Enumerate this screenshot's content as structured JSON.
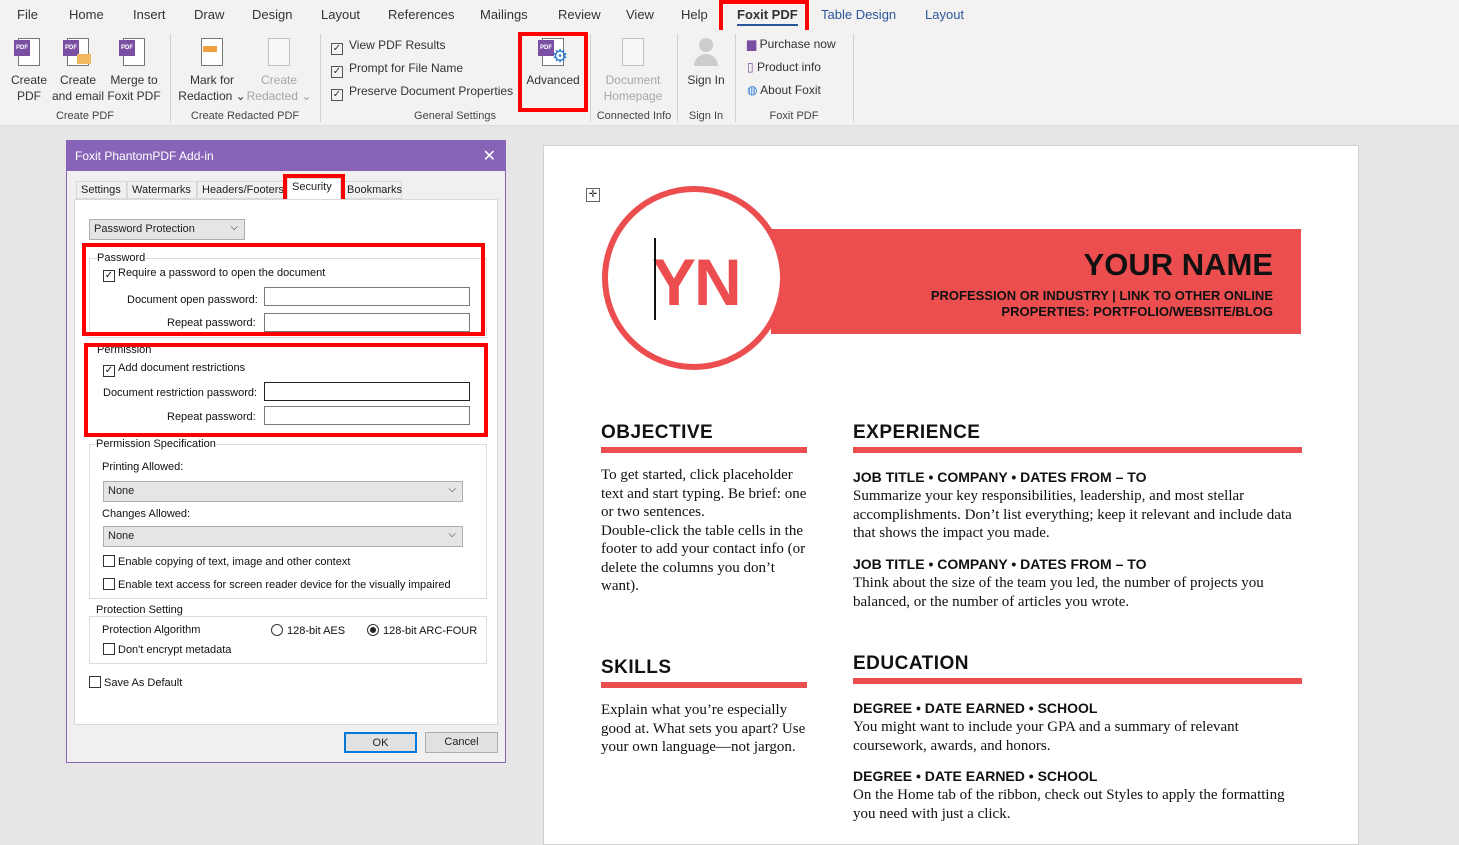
{
  "menu_tabs": [
    "File",
    "Home",
    "Insert",
    "Draw",
    "Design",
    "Layout",
    "References",
    "Mailings",
    "Review",
    "View",
    "Help",
    "Foxit PDF",
    "Table Design",
    "Layout"
  ],
  "ribbon": {
    "create_pdf": [
      "Create PDF",
      "Create and email",
      "Merge to Foxit PDF"
    ],
    "create_pdf_group": "Create PDF",
    "mark_redaction": "Mark for Redaction",
    "create_redacted": "Create Redacted",
    "redacted_group": "Create Redacted PDF",
    "checks": [
      "View PDF Results",
      "Prompt for File Name",
      "Preserve Document Properties"
    ],
    "advanced": "Advanced",
    "general_group": "General Settings",
    "doc_homepage": "Document Homepage",
    "connected_group": "Connected Info",
    "sign_in": "Sign In",
    "sign_in_group": "Sign In",
    "links": [
      "Purchase now",
      "Product info",
      "About Foxit"
    ],
    "foxit_group": "Foxit PDF"
  },
  "dialog": {
    "title": "Foxit PhantomPDF Add-in",
    "close": "✕",
    "tabs": [
      "Settings",
      "Watermarks",
      "Headers/Footers",
      "Security",
      "Bookmarks"
    ],
    "mode": "Password Protection",
    "password_legend": "Password",
    "require_password": "Require a password to open the document",
    "open_password": "Document open password:",
    "repeat_password": "Repeat password:",
    "permission_legend": "Permission",
    "add_restrictions": "Add document restrictions",
    "restriction_password": "Document restriction password:",
    "repeat_password2": "Repeat password:",
    "perm_spec_legend": "Permission Specification",
    "printing_allowed": "Printing Allowed:",
    "printing_value": "None",
    "changes_allowed": "Changes Allowed:",
    "changes_value": "None",
    "enable_copying": "Enable copying of text, image and other context",
    "enable_reader": "Enable text access for screen reader device for the visually impaired",
    "protection_legend": "Protection Setting",
    "algorithm_label": "Protection Algorithm",
    "aes": "128-bit AES",
    "arcfour": "128-bit ARC-FOUR",
    "dont_encrypt": "Don't encrypt metadata",
    "save_default": "Save As Default",
    "ok": "OK",
    "cancel": "Cancel"
  },
  "resume": {
    "initials": "YN",
    "name": "YOUR NAME",
    "subtitle1": "PROFESSION OR INDUSTRY | LINK TO OTHER ONLINE",
    "subtitle2": "PROPERTIES: PORTFOLIO/WEBSITE/BLOG",
    "objective_h": "OBJECTIVE",
    "objective": "To get started, click placeholder text and start typing. Be brief: one or two sentences.",
    "objective2": "Double-click the table cells in the footer to add your contact info (or delete the columns you don’t want).",
    "skills_h": "SKILLS",
    "skills": "Explain what you’re especially good at. What sets you apart? Use your own language—not jargon.",
    "experience_h": "EXPERIENCE",
    "job1": "JOB TITLE • COMPANY • DATES FROM – TO",
    "job1_text": "Summarize your key responsibilities, leadership, and most stellar accomplishments.  Don’t list everything; keep it relevant and include data that shows the impact you made.",
    "job2": "JOB TITLE • COMPANY • DATES FROM – TO",
    "job2_text": "Think about the size of the team you led, the number of projects you balanced, or the number of articles you wrote.",
    "education_h": "EDUCATION",
    "deg1": "DEGREE • DATE EARNED • SCHOOL",
    "deg1_text": "You might want to include your GPA and a summary of relevant coursework, awards, and honors.",
    "deg2": "DEGREE • DATE EARNED • SCHOOL",
    "deg2_text": "On the Home tab of the ribbon, check out Styles to apply the formatting you need with just a click."
  },
  "colors": {
    "accent": "#ec4e50",
    "dialog_title": "#8764b8",
    "highlight": "#ff0000"
  }
}
